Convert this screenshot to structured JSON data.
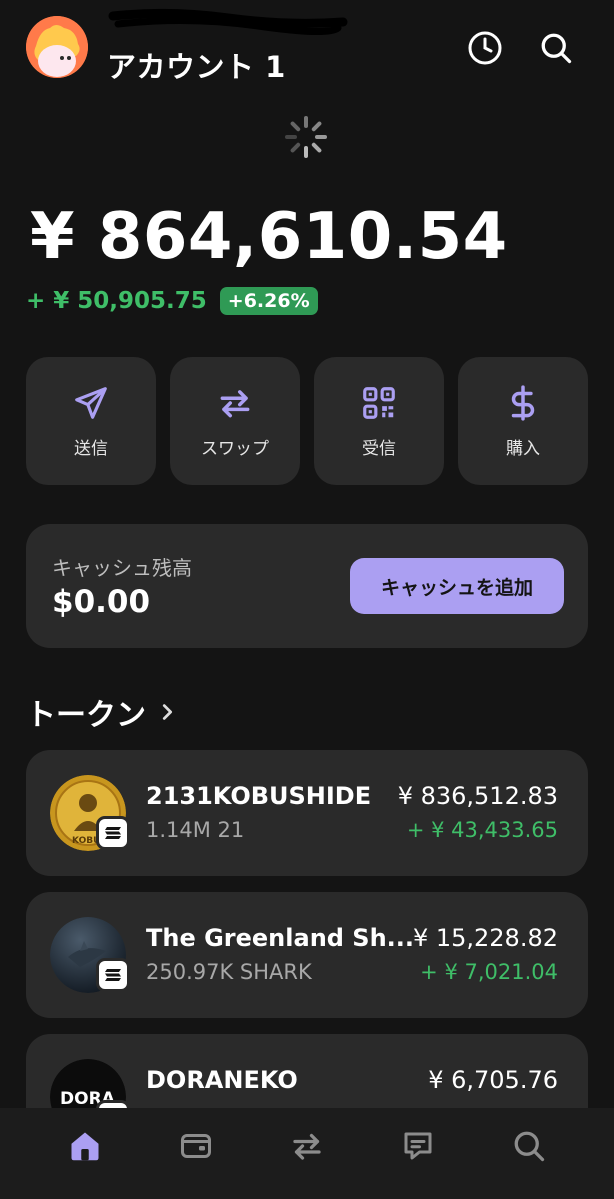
{
  "header": {
    "account_name": "アカウント 1",
    "history_icon": "clock-icon",
    "search_icon": "search-icon"
  },
  "balance": {
    "total": "¥ 864,610.54",
    "change_amount": "+ ¥ 50,905.75",
    "change_percent": "+6.26%"
  },
  "actions": [
    {
      "label": "送信",
      "icon": "send-icon"
    },
    {
      "label": "スワップ",
      "icon": "swap-icon"
    },
    {
      "label": "受信",
      "icon": "qr-code-icon"
    },
    {
      "label": "購入",
      "icon": "dollar-icon"
    }
  ],
  "cash": {
    "title": "キャッシュ残高",
    "value": "$0.00",
    "button_label": "キャッシュを追加"
  },
  "tokens": {
    "header": "トークン",
    "items": [
      {
        "name": "2131KOBUSHIDE",
        "amount": "1.14M 21",
        "value": "¥ 836,512.83",
        "change": "+ ¥ 43,433.65",
        "icon_text": "KOBU"
      },
      {
        "name": "The Greenland Sh...",
        "amount": "250.97K SHARK",
        "value": "¥ 15,228.82",
        "change": "+ ¥ 7,021.04",
        "icon_text": ""
      },
      {
        "name": "DORANEKO",
        "amount": "",
        "value": "¥ 6,705.76",
        "change": "",
        "icon_text": "DORA"
      }
    ]
  },
  "bottom_nav": [
    {
      "name": "home",
      "icon": "home-icon",
      "active": true
    },
    {
      "name": "wallet",
      "icon": "wallet-icon",
      "active": false
    },
    {
      "name": "swap",
      "icon": "swap-icon",
      "active": false
    },
    {
      "name": "messages",
      "icon": "chat-icon",
      "active": false
    },
    {
      "name": "search",
      "icon": "search-icon",
      "active": false
    }
  ],
  "colors": {
    "background": "#141414",
    "card": "#2a2a2a",
    "accent": "#ab9ff2",
    "positive": "#3fbe68"
  }
}
